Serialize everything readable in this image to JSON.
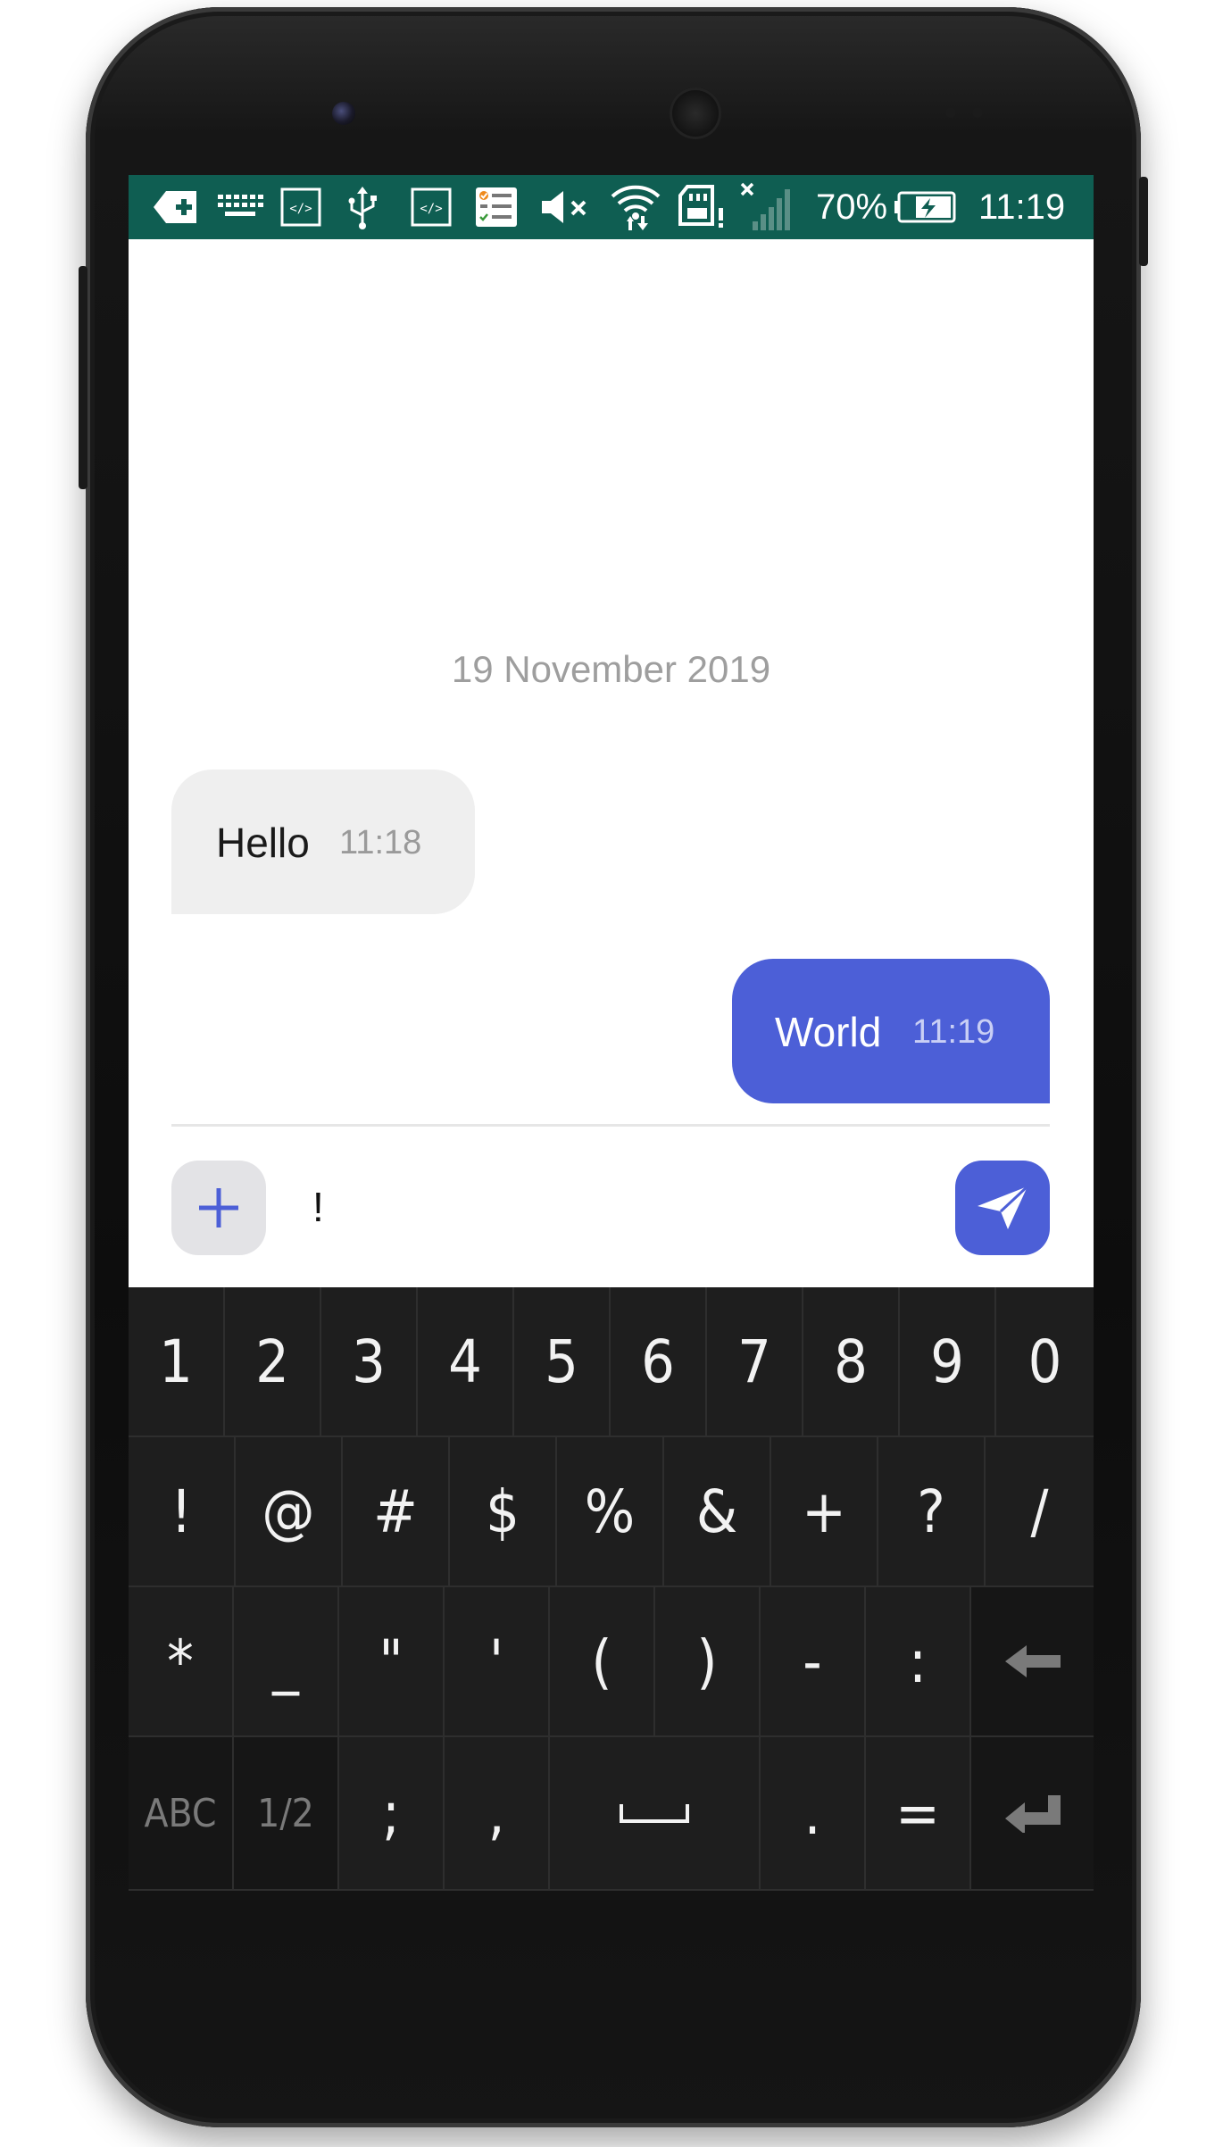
{
  "status_bar": {
    "battery_percent": "70%",
    "time": "11:19",
    "icons": [
      "add-box-icon",
      "keyboard-icon",
      "code-icon",
      "usb-icon",
      "code-icon",
      "checklist-icon",
      "volume-muted-icon",
      "wifi-icon",
      "sd-card-alert-icon",
      "signal-off-icon",
      "battery-charging-icon"
    ]
  },
  "chat": {
    "date_divider": "19 November 2019",
    "messages": [
      {
        "direction": "incoming",
        "text": "Hello",
        "time": "11:18"
      },
      {
        "direction": "outgoing",
        "text": "World",
        "time": "11:19"
      }
    ]
  },
  "composer": {
    "value": "!",
    "attach_icon": "plus-icon",
    "send_icon": "send-icon"
  },
  "keyboard": {
    "rows": [
      [
        "1",
        "2",
        "3",
        "4",
        "5",
        "6",
        "7",
        "8",
        "9",
        "0"
      ],
      [
        "!",
        "@",
        "#",
        "$",
        "%",
        "&",
        "+",
        "?",
        "/"
      ],
      [
        "*",
        "_",
        "\"",
        "'",
        "(",
        ")",
        "-",
        ":",
        "backspace"
      ],
      [
        "ABC",
        "1/2",
        ";",
        ",",
        "space",
        ".",
        "=",
        "enter"
      ]
    ],
    "labels": {
      "abc": "ABC",
      "page": "1/2"
    }
  },
  "colors": {
    "status_bar": "#0f5e52",
    "accent": "#4c5fd7",
    "incoming_bubble": "#efefef",
    "keyboard_bg": "#1e1e1e"
  }
}
